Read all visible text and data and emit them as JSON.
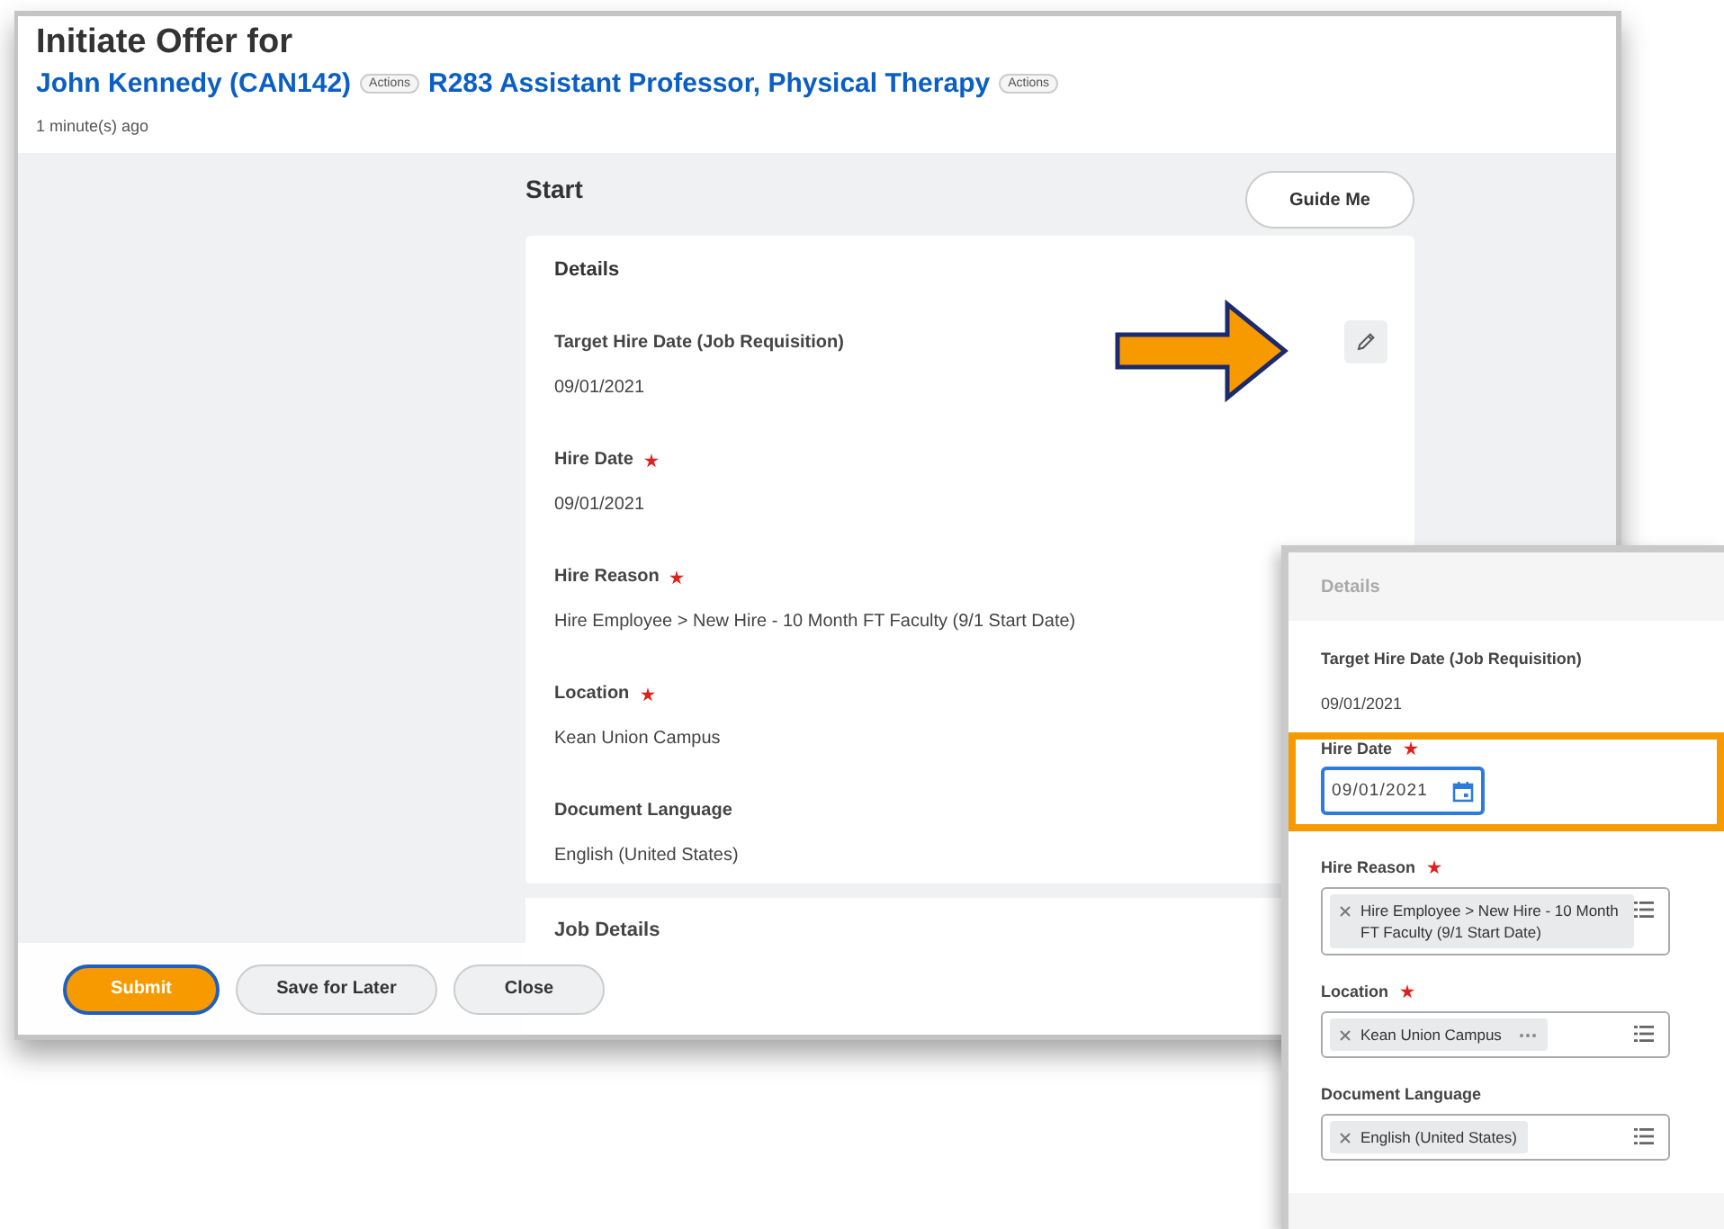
{
  "window": {
    "title": "Initiate Offer for",
    "links": [
      {
        "text": "John Kennedy (CAN142)",
        "actions": "Actions"
      },
      {
        "text": "R283 Assistant Professor, Physical Therapy",
        "actions": "Actions"
      }
    ],
    "timestamp": "1 minute(s) ago"
  },
  "page": {
    "heading": "Start",
    "guide_button": "Guide Me",
    "section": "Details",
    "fields": [
      {
        "label": "Target Hire Date (Job Requisition)",
        "required": false,
        "value": "09/01/2021"
      },
      {
        "label": "Hire Date",
        "required": true,
        "value": "09/01/2021"
      },
      {
        "label": "Hire Reason",
        "required": true,
        "value": "Hire Employee > New Hire - 10 Month FT Faculty (9/1 Start Date)"
      },
      {
        "label": "Location",
        "required": true,
        "value": "Kean Union Campus"
      },
      {
        "label": "Document Language",
        "required": false,
        "value": "English (United States)"
      }
    ],
    "next_section": "Job Details"
  },
  "footer": {
    "buttons": [
      {
        "label": "Submit",
        "kind": "primary"
      },
      {
        "label": "Save for Later",
        "kind": "secondary"
      },
      {
        "label": "Close",
        "kind": "secondary"
      }
    ]
  },
  "edit_panel": {
    "section": "Details",
    "fields": [
      {
        "kind": "text",
        "label": "Target Hire Date (Job Requisition)",
        "required": false,
        "value": "09/01/2021",
        "highlighted": false
      },
      {
        "kind": "date",
        "label": "Hire Date",
        "required": true,
        "value": "09/01/2021",
        "highlighted": true
      },
      {
        "kind": "multiselect",
        "label": "Hire Reason",
        "required": true,
        "chip": "Hire Employee > New Hire - 10 Month FT Faculty (9/1 Start Date)",
        "more": false,
        "highlighted": false
      },
      {
        "kind": "multiselect",
        "label": "Location",
        "required": true,
        "chip": "Kean Union Campus",
        "more": true,
        "highlighted": false
      },
      {
        "kind": "multiselect",
        "label": "Document Language",
        "required": false,
        "chip": "English (United States)",
        "more": false,
        "highlighted": false
      }
    ]
  }
}
